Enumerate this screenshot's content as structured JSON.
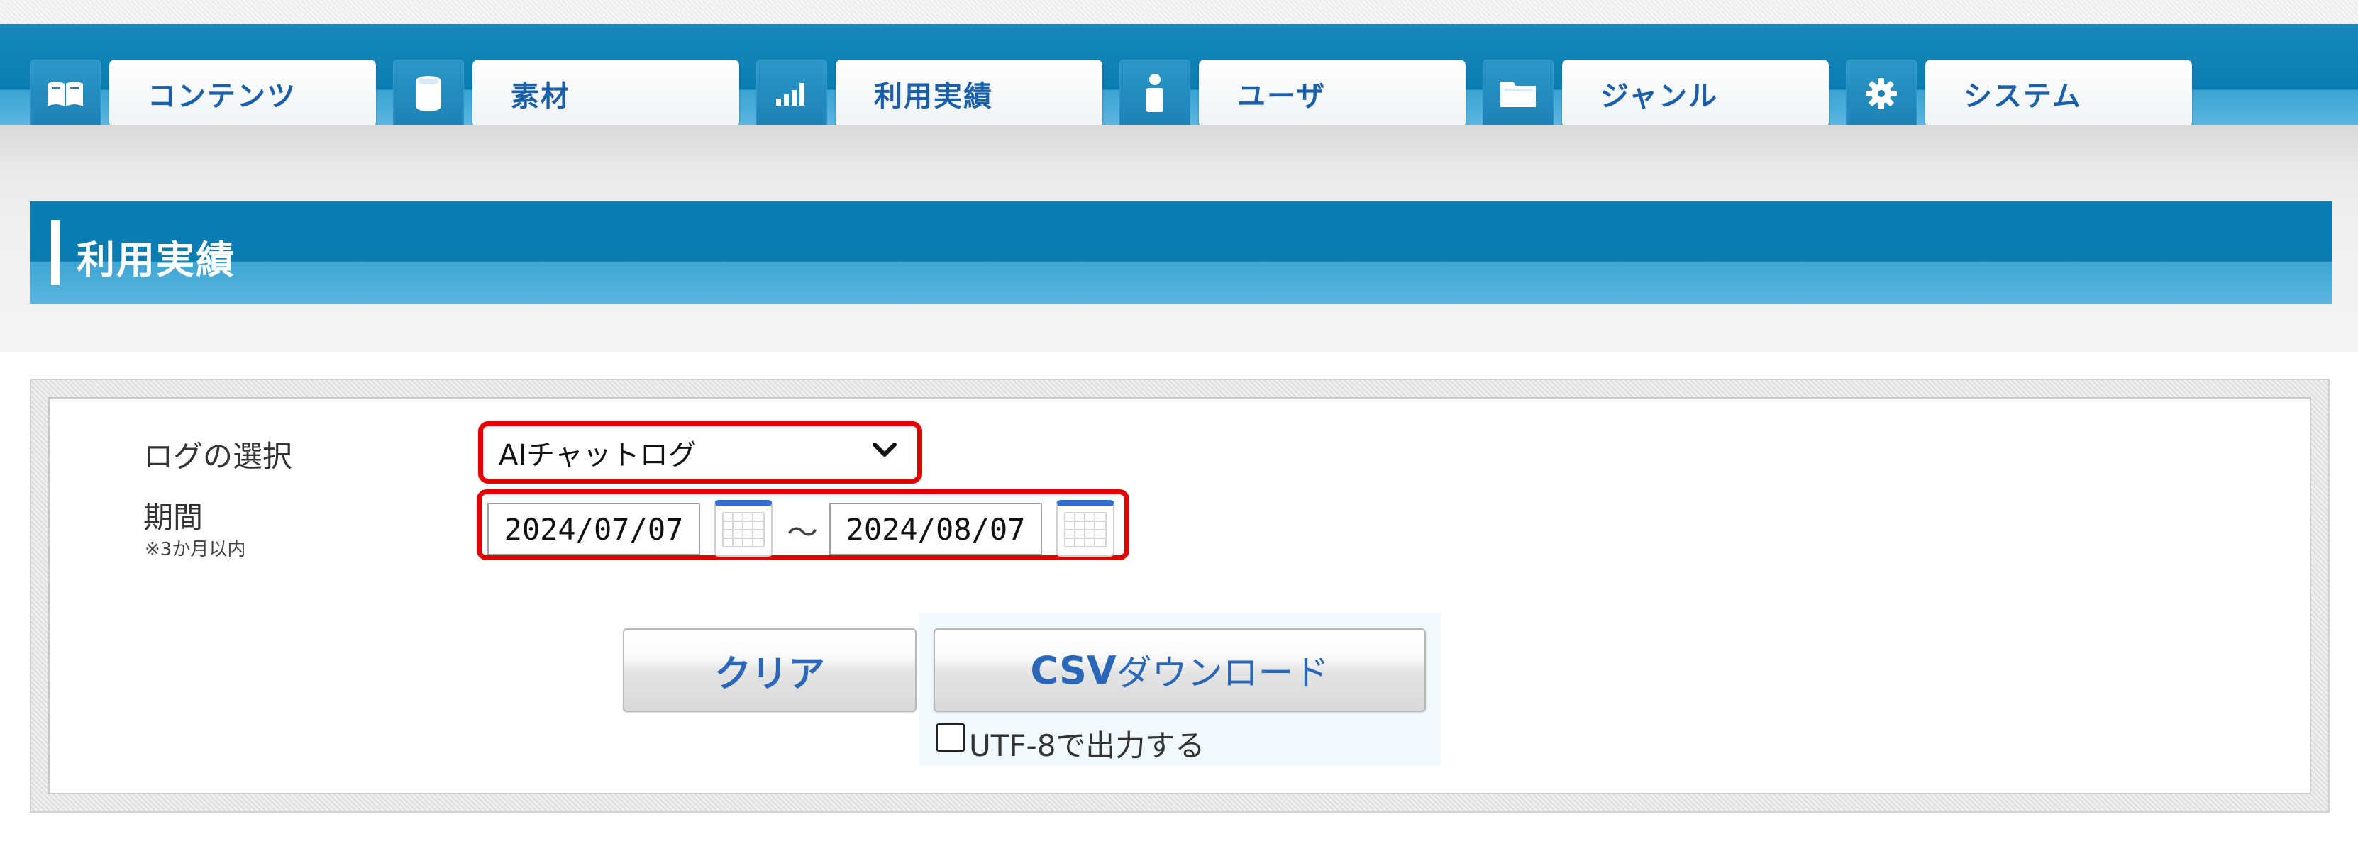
{
  "nav": {
    "items": [
      {
        "label": "コンテンツ",
        "icon": "book-icon"
      },
      {
        "label": "素材",
        "icon": "database-icon"
      },
      {
        "label": "利用実績",
        "icon": "bar-chart-icon"
      },
      {
        "label": "ユーザ",
        "icon": "person-icon"
      },
      {
        "label": "ジャンル",
        "icon": "folder-icon"
      },
      {
        "label": "システム",
        "icon": "gear-icon"
      }
    ]
  },
  "page": {
    "title": "利用実績"
  },
  "form": {
    "log_label": "ログの選択",
    "log_value": "AIチャットログ",
    "period_label": "期間",
    "period_note": "※3か月以内",
    "date_from": "2024/07/07",
    "tilde": "〜",
    "date_to": "2024/08/07"
  },
  "buttons": {
    "clear": "クリア",
    "csv_prefix": "CSV",
    "csv_suffix": "ダウンロード",
    "utf8_label": "UTF-8で出力する"
  },
  "colors": {
    "nav_blue": "#0a7db2",
    "highlight_red": "#e30000",
    "button_text": "#2a67b8"
  }
}
